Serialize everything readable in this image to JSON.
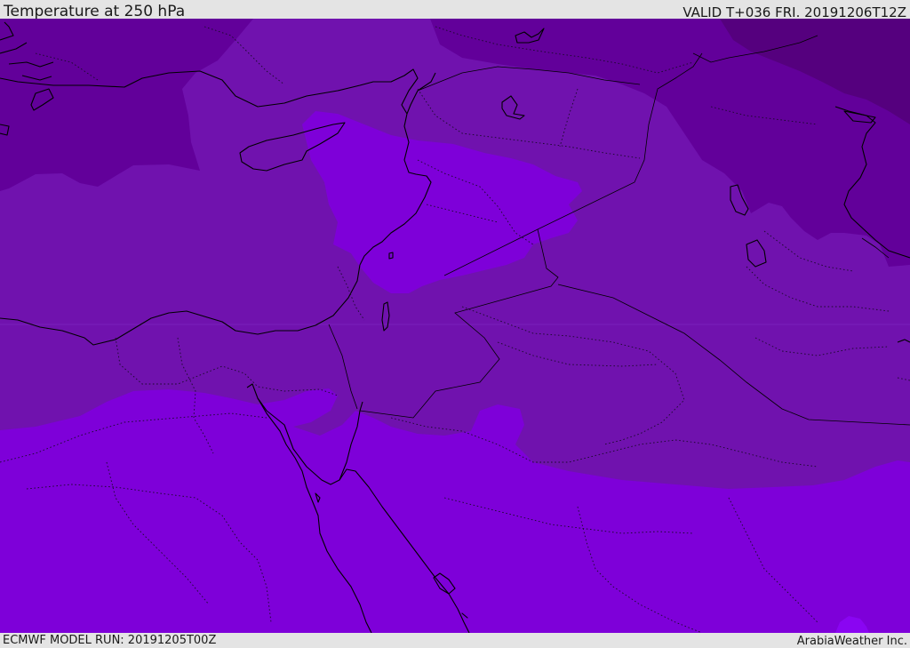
{
  "header": {
    "title": "Temperature at 250 hPa",
    "valid": "VALID T+036 FRI. 20191206T12Z"
  },
  "footer": {
    "model_run": "ECMWF MODEL RUN: 20191205T00Z",
    "credit": "ArabiaWeather Inc."
  },
  "map": {
    "variable": "temperature",
    "level": "250 hPa",
    "shading_colors": {
      "darkest": "#55007e",
      "dark": "#62009a",
      "medium": "#7012ae",
      "light": "#7e00d9",
      "lightest": "#8a05f2"
    },
    "line_colors": {
      "coastline": "#000000",
      "borders": "#000000",
      "admin_borders": "#2a0a3a"
    }
  }
}
